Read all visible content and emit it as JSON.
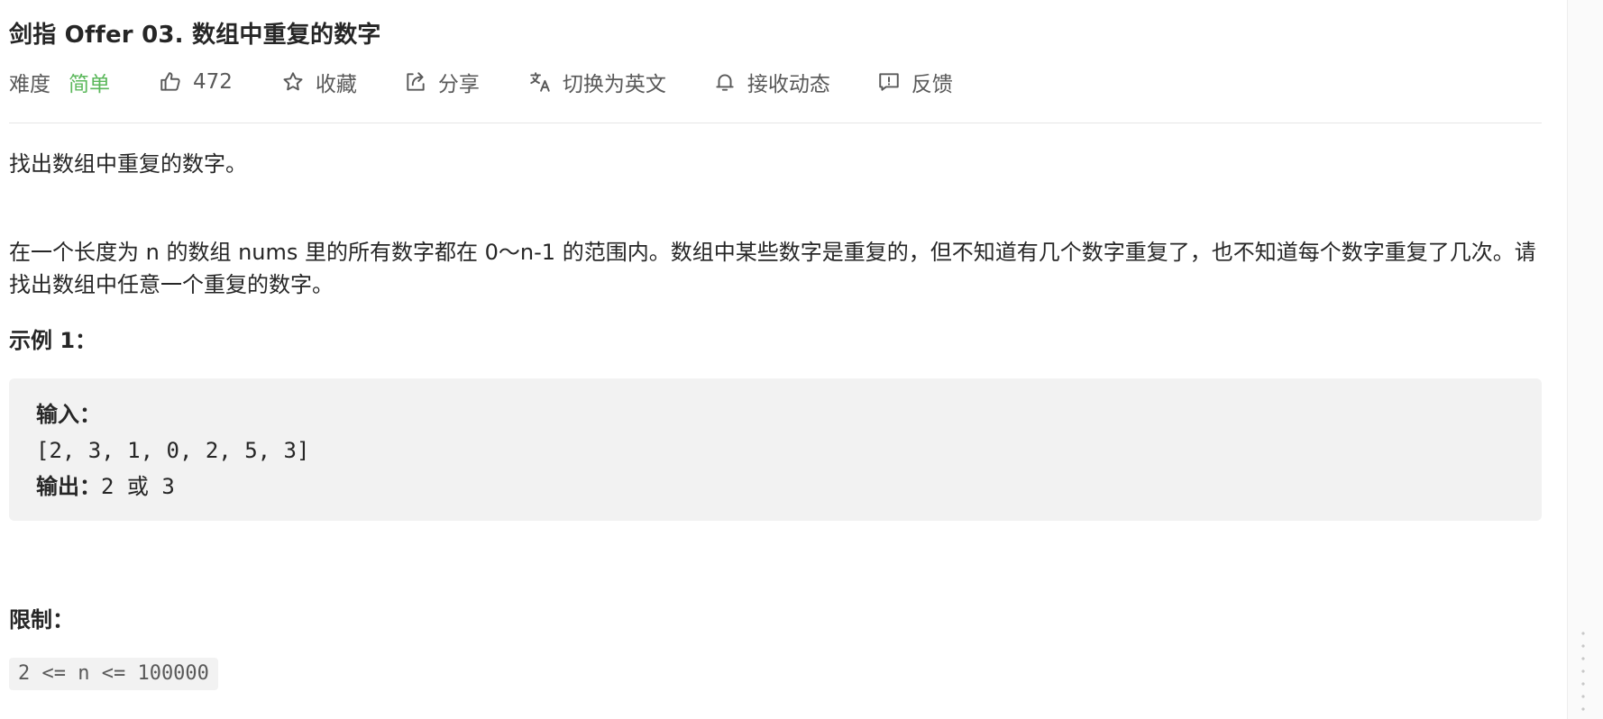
{
  "problem": {
    "title": "剑指 Offer 03. 数组中重复的数字",
    "difficulty_label": "难度",
    "difficulty_value": "简单",
    "difficulty_color": "#5cb85c"
  },
  "actions": {
    "likes": "472",
    "favorite": "收藏",
    "share": "分享",
    "translate": "切换为英文",
    "notify": "接收动态",
    "feedback": "反馈"
  },
  "description": {
    "p1": "找出数组中重复的数字。",
    "p2": "在一个长度为 n 的数组 nums 里的所有数字都在 0～n-1 的范围内。数组中某些数字是重复的，但不知道有几个数字重复了，也不知道每个数字重复了几次。请找出数组中任意一个重复的数字。"
  },
  "example": {
    "title": "示例 1：",
    "input_label": "输入：",
    "input_value": "[2, 3, 1, 0, 2, 5, 3]",
    "output_label": "输出：",
    "output_value": "2 或 3"
  },
  "constraints": {
    "title": "限制：",
    "code": "2 <= n <= 100000"
  },
  "icons": {
    "like": "thumbs-up-icon",
    "favorite": "star-icon",
    "share": "share-icon",
    "translate": "translate-icon",
    "notify": "bell-icon",
    "feedback": "feedback-icon"
  }
}
